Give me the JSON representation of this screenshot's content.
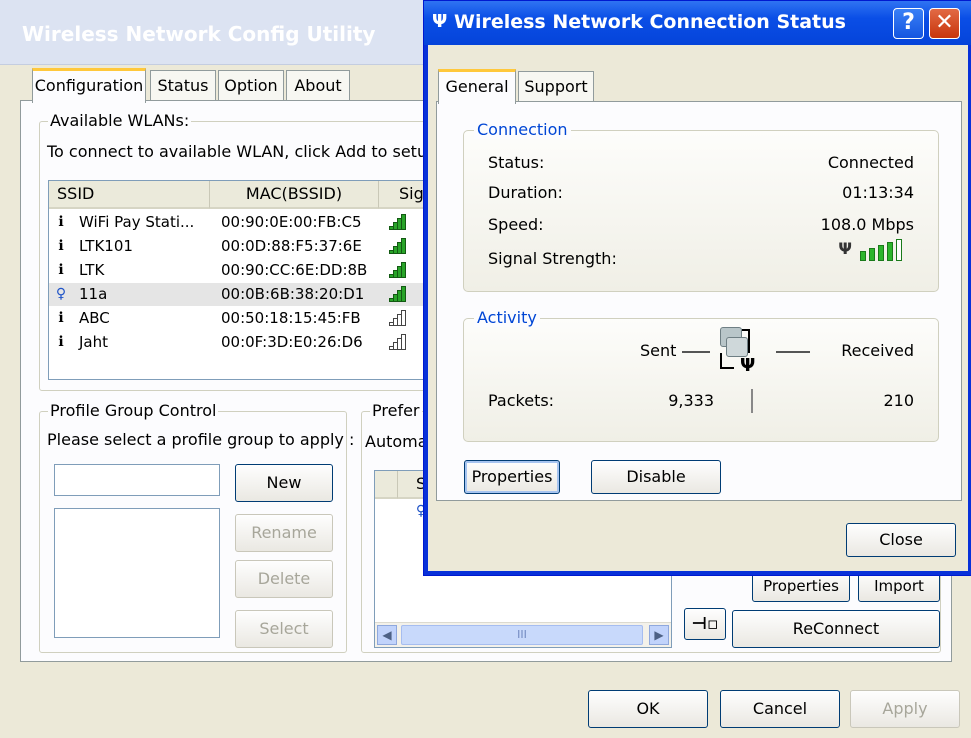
{
  "back": {
    "title": "Wireless Network Config Utility",
    "tabs": [
      "Configuration",
      "Status",
      "Option",
      "About"
    ],
    "available": {
      "group_label": "Available WLANs:",
      "hint": "To connect to available WLAN, click Add to setu",
      "columns": [
        "SSID",
        "MAC(BSSID)",
        "Sig"
      ],
      "rows": [
        {
          "ssid": "WiFi Pay Stati...",
          "mac": "00:90:0E:00:FB:C5",
          "grey": false,
          "selected": false
        },
        {
          "ssid": "LTK101",
          "mac": "00:0D:88:F5:37:6E",
          "grey": false,
          "selected": false
        },
        {
          "ssid": "LTK",
          "mac": "00:90:CC:6E:DD:8B",
          "grey": false,
          "selected": false
        },
        {
          "ssid": "11a",
          "mac": "00:0B:6B:38:20:D1",
          "grey": false,
          "selected": true
        },
        {
          "ssid": "ABC",
          "mac": "00:50:18:15:45:FB",
          "grey": true,
          "selected": false
        },
        {
          "ssid": "Jaht",
          "mac": "00:0F:3D:E0:26:D6",
          "grey": true,
          "selected": false
        }
      ]
    },
    "profile": {
      "group_label": "Profile Group Control",
      "prompt": "Please select a profile group to apply :",
      "new_label": "New",
      "rename_label": "Rename",
      "delete_label": "Delete",
      "select_label": "Select"
    },
    "preferred": {
      "group_label": "Prefer",
      "auto_text": "Automa",
      "col_text": "S",
      "scroll_thumb": "III",
      "properties_label": "Properties",
      "import_label": "Import",
      "reconnect_label": "ReConnect"
    },
    "footer": {
      "ok_label": "OK",
      "cancel_label": "Cancel",
      "apply_label": "Apply"
    }
  },
  "dialog": {
    "title": "Wireless Network Connection Status",
    "help_glyph": "?",
    "close_glyph": "✕",
    "tabs": [
      "General",
      "Support"
    ],
    "connection": {
      "group_label": "Connection",
      "status_label": "Status:",
      "status_value": "Connected",
      "duration_label": "Duration:",
      "duration_value": "01:13:34",
      "speed_label": "Speed:",
      "speed_value": "108.0 Mbps",
      "signal_label": "Signal Strength:",
      "signal_bars": 5
    },
    "activity": {
      "group_label": "Activity",
      "sent_label": "Sent",
      "received_label": "Received",
      "packets_label": "Packets:",
      "packets_sent": "9,333",
      "packets_received": "210"
    },
    "properties_label": "Properties",
    "disable_label": "Disable",
    "close_label": "Close"
  }
}
